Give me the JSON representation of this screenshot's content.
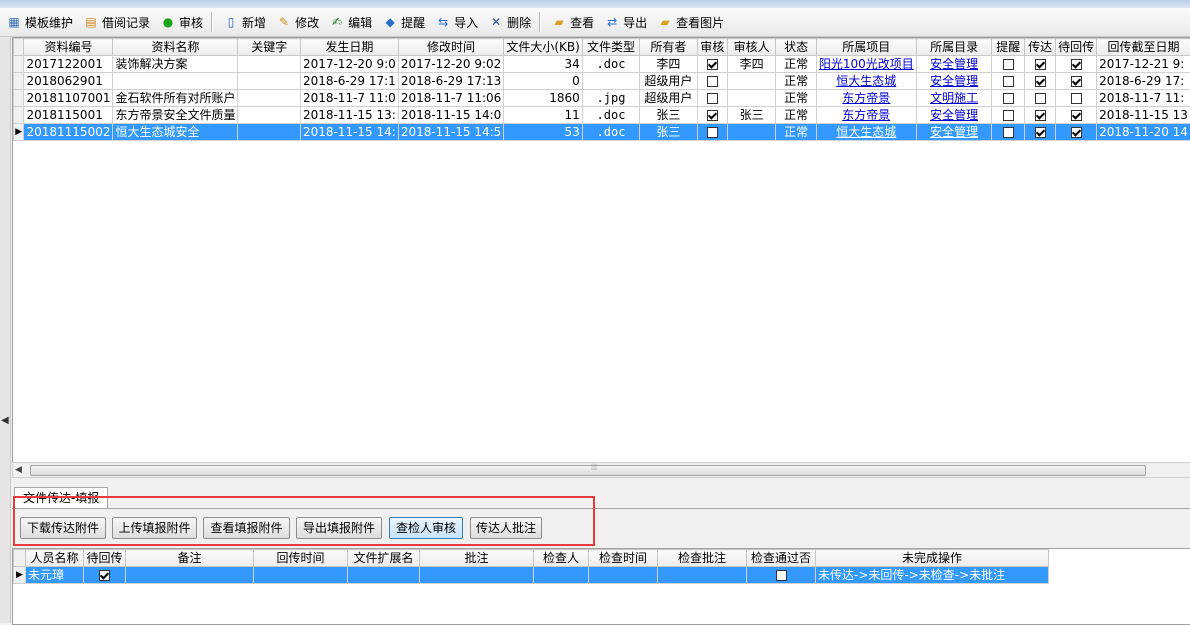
{
  "toolbar": [
    {
      "id": "template",
      "label": "模板维护",
      "icon": "table-icon",
      "glyph": "▦",
      "color": "#3b6fb5"
    },
    {
      "id": "borrow",
      "label": "借阅记录",
      "icon": "record-icon",
      "glyph": "▤",
      "color": "#d08a1c"
    },
    {
      "id": "audit",
      "label": "审核",
      "icon": "green-dot-icon",
      "glyph": "●",
      "color": "#1aa51a"
    },
    {
      "sep": true
    },
    {
      "id": "new",
      "label": "新增",
      "icon": "new-doc-icon",
      "glyph": "▯",
      "color": "#2a5fa6"
    },
    {
      "id": "edit",
      "label": "修改",
      "icon": "wand-icon",
      "glyph": "✎",
      "color": "#c8901a"
    },
    {
      "id": "compose",
      "label": "编辑",
      "icon": "compose-icon",
      "glyph": "✍",
      "color": "#2b7a2b"
    },
    {
      "id": "remind",
      "label": "提醒",
      "icon": "diamond-icon",
      "glyph": "◆",
      "color": "#2a6fd0"
    },
    {
      "id": "import",
      "label": "导入",
      "icon": "import-icon",
      "glyph": "⇆",
      "color": "#2a6fd0"
    },
    {
      "id": "delete",
      "label": "删除",
      "icon": "delete-x-icon",
      "glyph": "✕",
      "color": "#2a4fa6"
    },
    {
      "sep": true
    },
    {
      "id": "view",
      "label": "查看",
      "icon": "folder-open-icon",
      "glyph": "▰",
      "color": "#d6a21e"
    },
    {
      "id": "export",
      "label": "导出",
      "icon": "export-icon",
      "glyph": "⇄",
      "color": "#2a6fd0"
    },
    {
      "id": "viewimg",
      "label": "查看图片",
      "icon": "folder-image-icon",
      "glyph": "▰",
      "color": "#d6a21e"
    }
  ],
  "main_grid": {
    "columns": [
      "资料编号",
      "资料名称",
      "关键字",
      "发生日期",
      "修改时间",
      "文件大小(KB)",
      "文件类型",
      "所有者",
      "审核",
      "审核人",
      "状态",
      "所属项目",
      "所属目录",
      "提醒",
      "传达",
      "待回传",
      "回传截至日期"
    ],
    "rows": [
      {
        "code": "2017122001",
        "name": "装饰解决方案",
        "keyword": "",
        "date": "2017-12-20 9:0",
        "modified": "2017-12-20 9:02",
        "size": "34",
        "type": ".doc",
        "owner": "李四",
        "audited": true,
        "auditor": "李四",
        "status": "正常",
        "project": "阳光100光改项目",
        "catalog": "安全管理",
        "remind": false,
        "conveyed": true,
        "pending": true,
        "deadline": "2017-12-21 9:",
        "selected": false
      },
      {
        "code": "2018062901",
        "name": "",
        "keyword": "",
        "date": "2018-6-29 17:1",
        "modified": "2018-6-29 17:13",
        "size": "0",
        "type": "",
        "owner": "超级用户",
        "audited": false,
        "auditor": "",
        "status": "正常",
        "project": "恒大生态城",
        "catalog": "安全管理",
        "remind": false,
        "conveyed": true,
        "pending": true,
        "deadline": "2018-6-29 17:",
        "selected": false
      },
      {
        "code": "20181107001",
        "name": "金石软件所有对所账户",
        "keyword": "",
        "date": "2018-11-7 11:0",
        "modified": "2018-11-7 11:06",
        "size": "1860",
        "type": ".jpg",
        "owner": "超级用户",
        "audited": false,
        "auditor": "",
        "status": "正常",
        "project": "东方帝景",
        "catalog": "文明施工",
        "remind": false,
        "conveyed": false,
        "pending": false,
        "deadline": "2018-11-7 11:",
        "selected": false
      },
      {
        "code": "2018115001",
        "name": "东方帝景安全文件质量",
        "keyword": "",
        "date": "2018-11-15 13:",
        "modified": "2018-11-15 14:0",
        "size": "11",
        "type": ".doc",
        "owner": "张三",
        "audited": true,
        "auditor": "张三",
        "status": "正常",
        "project": "东方帝景",
        "catalog": "安全管理",
        "remind": false,
        "conveyed": true,
        "pending": true,
        "deadline": "2018-11-15 13",
        "selected": false
      },
      {
        "code": "20181115002",
        "name": "恒大生态城安全",
        "keyword": "",
        "date": "2018-11-15 14:",
        "modified": "2018-11-15 14:5",
        "size": "53",
        "type": ".doc",
        "owner": "张三",
        "audited": false,
        "auditor": "",
        "status": "正常",
        "project": "恒大生态城",
        "catalog": "安全管理",
        "remind": false,
        "conveyed": true,
        "pending": true,
        "deadline": "2018-11-20 14",
        "selected": true
      }
    ]
  },
  "tab": {
    "label": "文件传达-填报"
  },
  "actions": [
    "下载传达附件",
    "上传填报附件",
    "查看填报附件",
    "导出填报附件",
    "查检人审核",
    "传达人批注"
  ],
  "sub_grid": {
    "columns": [
      "人员名称",
      "待回传",
      "备注",
      "回传时间",
      "文件扩展名",
      "批注",
      "检查人",
      "检查时间",
      "检查批注",
      "检查通过否",
      "未完成操作"
    ],
    "rows": [
      {
        "name": "未元璋",
        "pending": true,
        "note": "",
        "time": "",
        "ext": "",
        "annotation": "",
        "checker": "",
        "check_time": "",
        "check_note": "",
        "passed": false,
        "incomplete": "未传达->未回传->未检查->未批注",
        "selected": true
      }
    ]
  }
}
